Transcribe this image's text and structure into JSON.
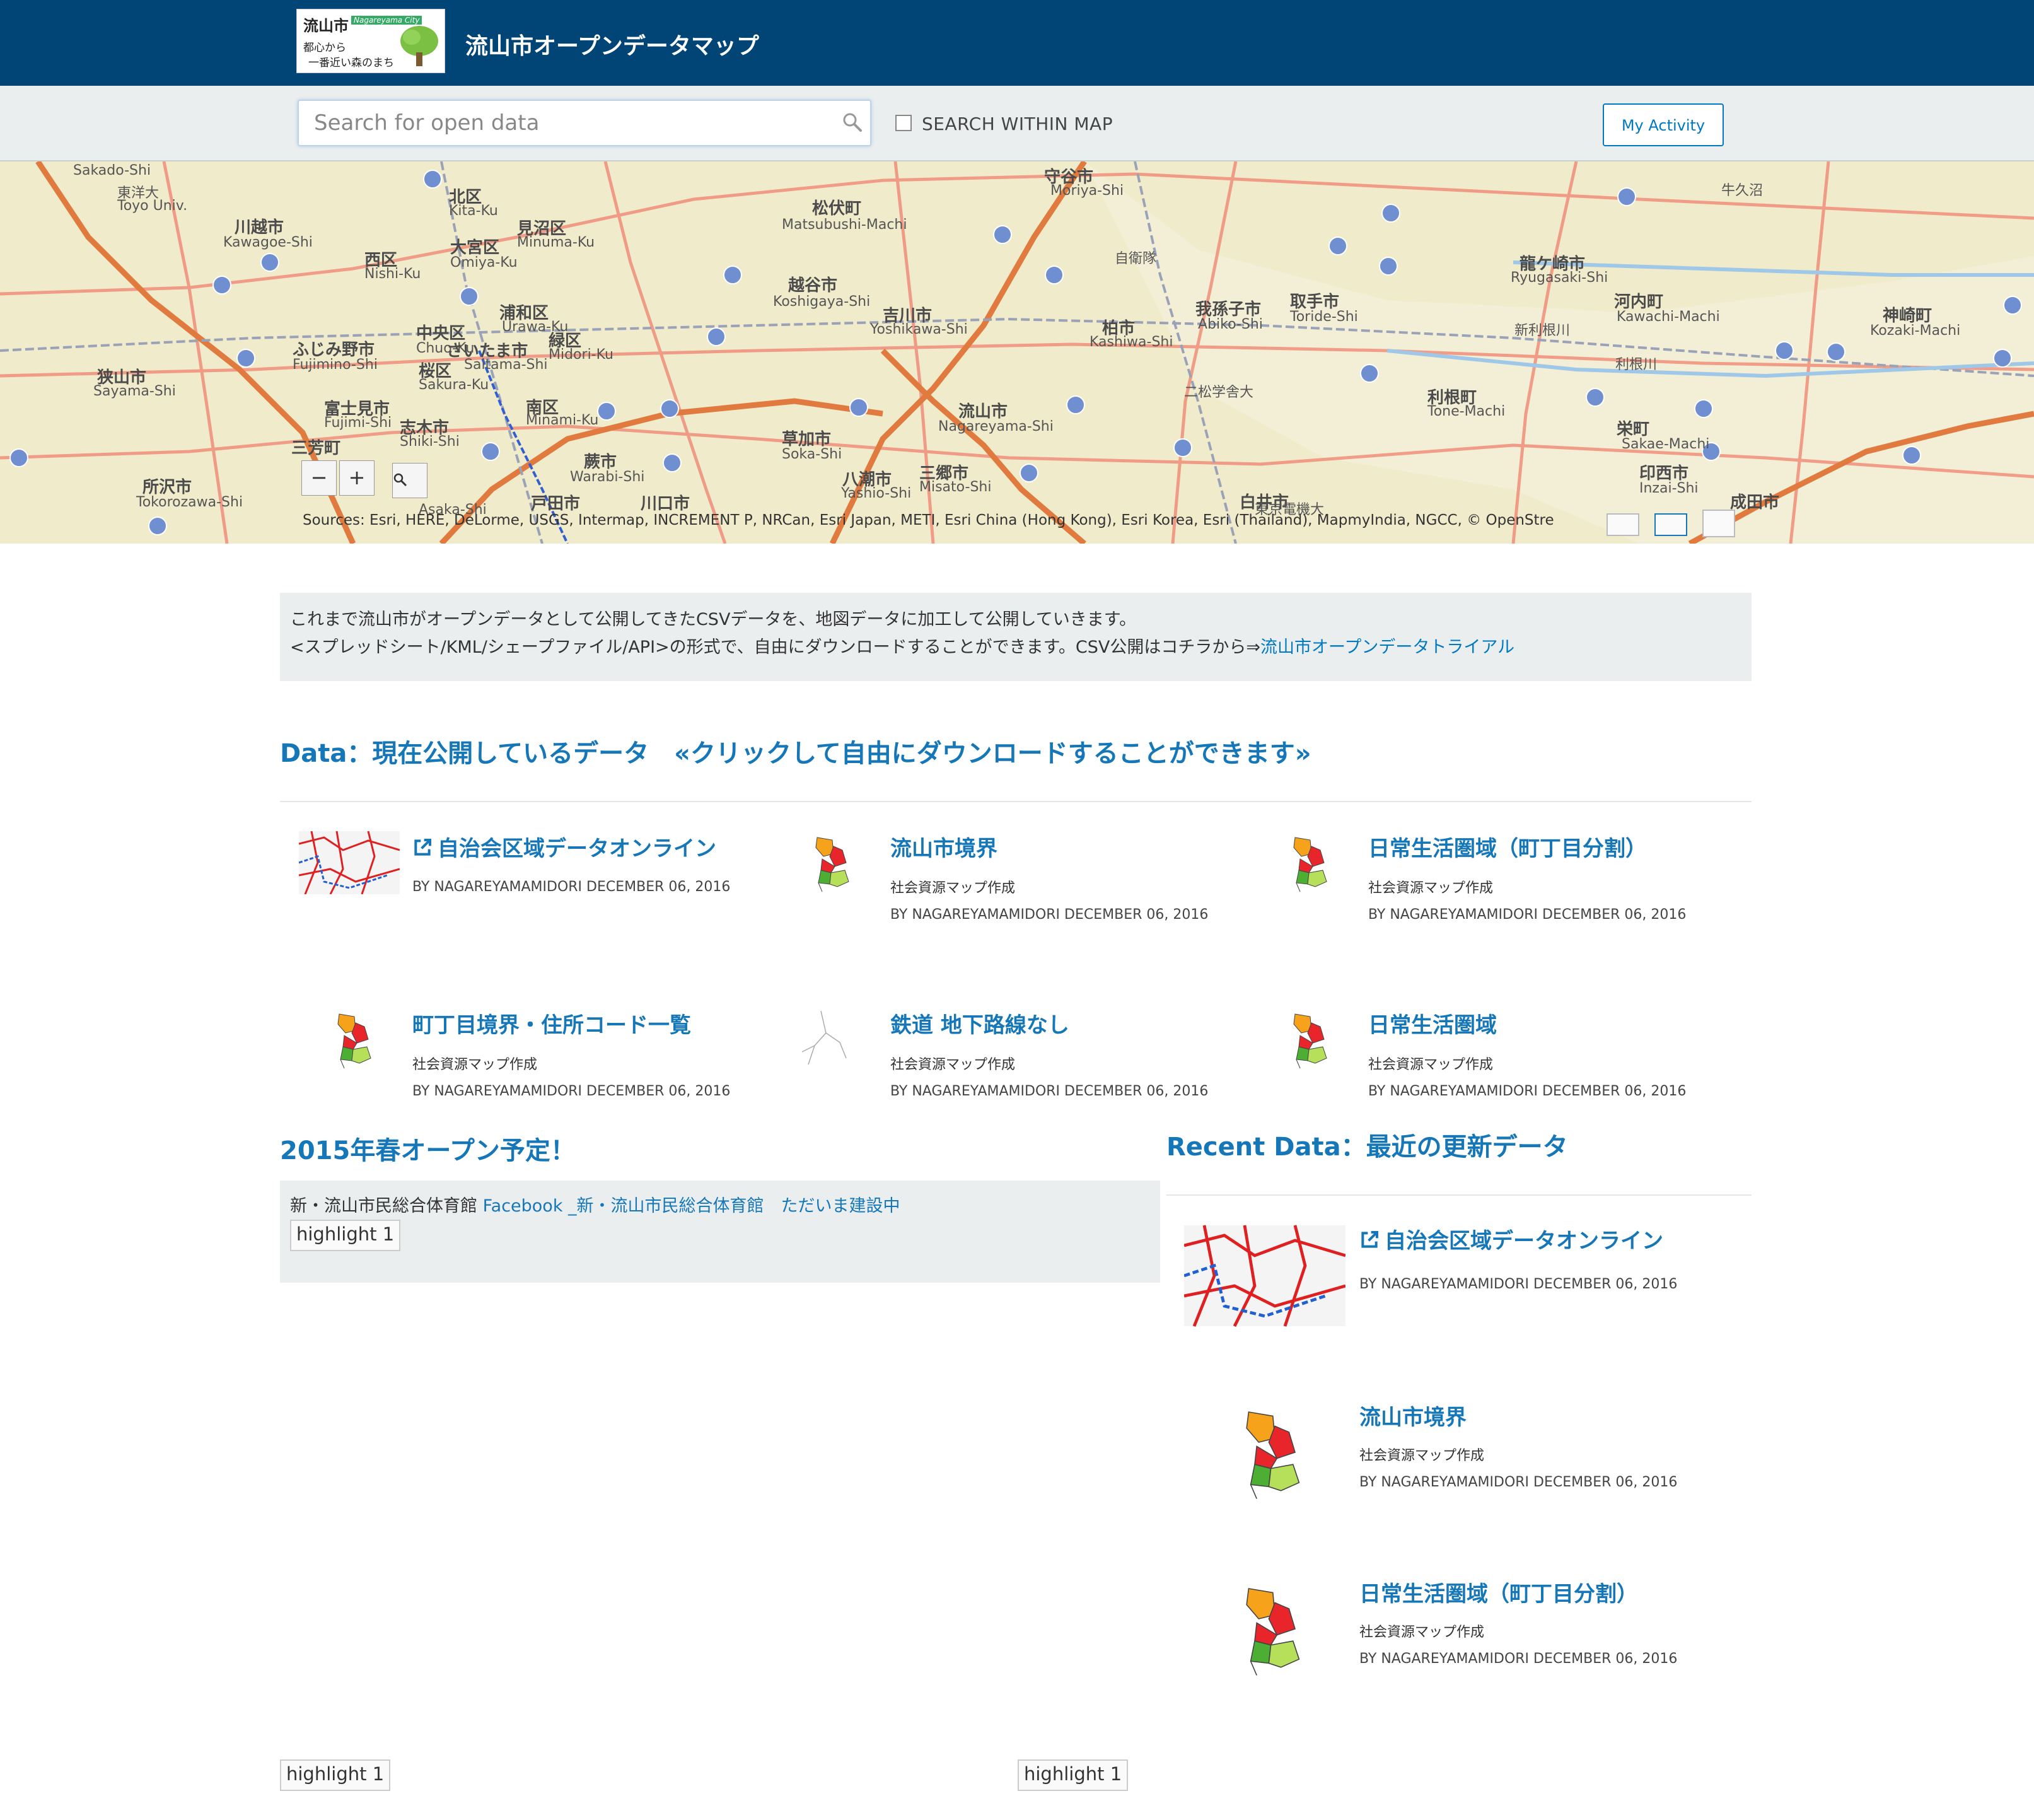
{
  "header": {
    "logo_kanji": "流山市",
    "logo_city": "Nagareyama City",
    "logo_slogan_1": "都心から",
    "logo_slogan_2": "一番近い森のまち",
    "title": "流山市オープンデータマップ"
  },
  "search": {
    "placeholder": "Search for open data",
    "within_map_label": "SEARCH WITHIN MAP",
    "my_activity_label": "My Activity"
  },
  "map": {
    "zoom_out": "−",
    "zoom_in": "+",
    "attribution": "Sources: Esri, HERE, DeLorme, USGS, Intermap, INCREMENT P, NRCan, Esri Japan, METI, Esri China (Hong Kong), Esri Korea, Esri (Thailand), MapmyIndia, NGCC, © OpenStre",
    "labels": [
      {
        "text": "Sakado-Shi",
        "big": false
      },
      {
        "text": "東洋大",
        "big": false
      },
      {
        "text": "Toyo Univ.",
        "big": false
      },
      {
        "text": "川越市",
        "big": true
      },
      {
        "text": "Kawagoe-Shi",
        "big": false
      },
      {
        "text": "北区",
        "big": true
      },
      {
        "text": "Kita-Ku",
        "big": false
      },
      {
        "text": "見沼区",
        "big": true
      },
      {
        "text": "Minuma-Ku",
        "big": false
      },
      {
        "text": "西区",
        "big": true
      },
      {
        "text": "Nishi-Ku",
        "big": false
      },
      {
        "text": "大宮区",
        "big": true
      },
      {
        "text": "Omiya-Ku",
        "big": false
      },
      {
        "text": "松伏町",
        "big": true
      },
      {
        "text": "Matsubushi-Machi",
        "big": false
      },
      {
        "text": "越谷市",
        "big": true
      },
      {
        "text": "Koshigaya-Shi",
        "big": false
      },
      {
        "text": "吉川市",
        "big": true
      },
      {
        "text": "Yoshikawa-Shi",
        "big": false
      },
      {
        "text": "ふじみ野市",
        "big": true
      },
      {
        "text": "Fujimino-Shi",
        "big": false
      },
      {
        "text": "中央区",
        "big": true
      },
      {
        "text": "Chuo-Ku",
        "big": false
      },
      {
        "text": "浦和区",
        "big": true
      },
      {
        "text": "Urawa-Ku",
        "big": false
      },
      {
        "text": "さいたま市",
        "big": true
      },
      {
        "text": "Saitama-Shi",
        "big": false
      },
      {
        "text": "緑区",
        "big": true
      },
      {
        "text": "Midori-Ku",
        "big": false
      },
      {
        "text": "桜区",
        "big": true
      },
      {
        "text": "Sakura-Ku",
        "big": false
      },
      {
        "text": "狭山市",
        "big": true
      },
      {
        "text": "Sayama-Shi",
        "big": false
      },
      {
        "text": "富士見市",
        "big": true
      },
      {
        "text": "Fujimi-Shi",
        "big": false
      },
      {
        "text": "志木市",
        "big": true
      },
      {
        "text": "Shiki-Shi",
        "big": false
      },
      {
        "text": "南区",
        "big": true
      },
      {
        "text": "Minami-Ku",
        "big": false
      },
      {
        "text": "三芳町",
        "big": true
      },
      {
        "text": "草加市",
        "big": true
      },
      {
        "text": "Soka-Shi",
        "big": false
      },
      {
        "text": "流山市",
        "big": true
      },
      {
        "text": "Nagareyama-Shi",
        "big": false
      },
      {
        "text": "柏市",
        "big": true
      },
      {
        "text": "Kashiwa-Shi",
        "big": false
      },
      {
        "text": "我孫子市",
        "big": true
      },
      {
        "text": "Abiko-Shi",
        "big": false
      },
      {
        "text": "取手市",
        "big": true
      },
      {
        "text": "Toride-Shi",
        "big": false
      },
      {
        "text": "龍ケ崎市",
        "big": true
      },
      {
        "text": "Ryugasaki-Shi",
        "big": false
      },
      {
        "text": "河内町",
        "big": true
      },
      {
        "text": "Kawachi-Machi",
        "big": false
      },
      {
        "text": "神崎町",
        "big": true
      },
      {
        "text": "Kozaki-Machi",
        "big": false
      },
      {
        "text": "所沢市",
        "big": true
      },
      {
        "text": "Tokorozawa-Shi",
        "big": false
      },
      {
        "text": "蕨市",
        "big": true
      },
      {
        "text": "Warabi-Shi",
        "big": false
      },
      {
        "text": "戸田市",
        "big": true
      },
      {
        "text": "川口市",
        "big": true
      },
      {
        "text": "八潮市",
        "big": true
      },
      {
        "text": "Yashio-Shi",
        "big": false
      },
      {
        "text": "三郷市",
        "big": true
      },
      {
        "text": "Misato-Shi",
        "big": false
      },
      {
        "text": "利根町",
        "big": true
      },
      {
        "text": "Tone-Machi",
        "big": false
      },
      {
        "text": "栄町",
        "big": true
      },
      {
        "text": "Sakae-Machi",
        "big": false
      },
      {
        "text": "印西市",
        "big": true
      },
      {
        "text": "Inzai-Shi",
        "big": false
      },
      {
        "text": "白井市",
        "big": true
      },
      {
        "text": "成田市",
        "big": true
      },
      {
        "text": "守谷市",
        "big": true
      },
      {
        "text": "Moriya-Shi",
        "big": false
      },
      {
        "text": "新利根川",
        "big": false
      },
      {
        "text": "利根川",
        "big": false
      },
      {
        "text": "牛久沼",
        "big": false
      },
      {
        "text": "自衛隊",
        "big": false
      },
      {
        "text": "二松学舎大",
        "big": false
      },
      {
        "text": "Asaka-Shi",
        "big": false
      },
      {
        "text": "東京電機大",
        "big": false
      }
    ]
  },
  "intro": {
    "line1": "これまで流山市がオープンデータとして公開してきたCSVデータを、地図データに加工して公開していきます。",
    "line2_prefix": "<スプレッドシート/KML/シェープファイル/API>の形式で、自由にダウンロードすることができます。CSV公開はコチラから⇒",
    "line2_link": "流山市オープンデータトライアル"
  },
  "data_section": {
    "heading": "Data：現在公開しているデータ　«クリックして自由にダウンロードすることができます»",
    "items": [
      {
        "title": "自治会区域データオンライン",
        "subtitle": "",
        "meta": "BY NAGAREYAMAMIDORI DECEMBER 06, 2016",
        "external": true,
        "thumb": "map"
      },
      {
        "title": "流山市境界",
        "subtitle": "社会資源マップ作成",
        "meta": "BY NAGAREYAMAMIDORI DECEMBER 06, 2016",
        "external": false,
        "thumb": "city"
      },
      {
        "title": "日常生活圏域（町丁目分割）",
        "subtitle": "社会資源マップ作成",
        "meta": "BY NAGAREYAMAMIDORI DECEMBER 06, 2016",
        "external": false,
        "thumb": "city"
      },
      {
        "title": "町丁目境界・住所コード一覧",
        "subtitle": "社会資源マップ作成",
        "meta": "BY NAGAREYAMAMIDORI DECEMBER 06, 2016",
        "external": false,
        "thumb": "city"
      },
      {
        "title": "鉄道 地下路線なし",
        "subtitle": "社会資源マップ作成",
        "meta": "BY NAGAREYAMAMIDORI DECEMBER 06, 2016",
        "external": false,
        "thumb": "rail"
      },
      {
        "title": "日常生活圏域",
        "subtitle": "社会資源マップ作成",
        "meta": "BY NAGAREYAMAMIDORI DECEMBER 06, 2016",
        "external": false,
        "thumb": "city"
      }
    ]
  },
  "spring": {
    "heading": "2015年春オープン予定！",
    "text_prefix": "新・流山市民総合体育館 ",
    "link": "Facebook _新・流山市民総合体育館　ただいま建設中",
    "img_alt": "highlight 1"
  },
  "recent": {
    "heading": "Recent Data：最近の更新データ",
    "items": [
      {
        "title": "自治会区域データオンライン",
        "subtitle": "",
        "meta": "BY NAGAREYAMAMIDORI DECEMBER 06, 2016",
        "external": true,
        "thumb": "map"
      },
      {
        "title": "流山市境界",
        "subtitle": "社会資源マップ作成",
        "meta": "BY NAGAREYAMAMIDORI DECEMBER 06, 2016",
        "external": false,
        "thumb": "city"
      },
      {
        "title": "日常生活圏域（町丁目分割）",
        "subtitle": "社会資源マップ作成",
        "meta": "BY NAGAREYAMAMIDORI DECEMBER 06, 2016",
        "external": false,
        "thumb": "city"
      }
    ]
  },
  "footer_highlights": [
    {
      "alt": "highlight 1"
    },
    {
      "alt": "highlight 1"
    }
  ],
  "colors": {
    "header_bg": "#004575",
    "link_blue": "#1577b8",
    "panel_bg": "#ebeeef"
  }
}
